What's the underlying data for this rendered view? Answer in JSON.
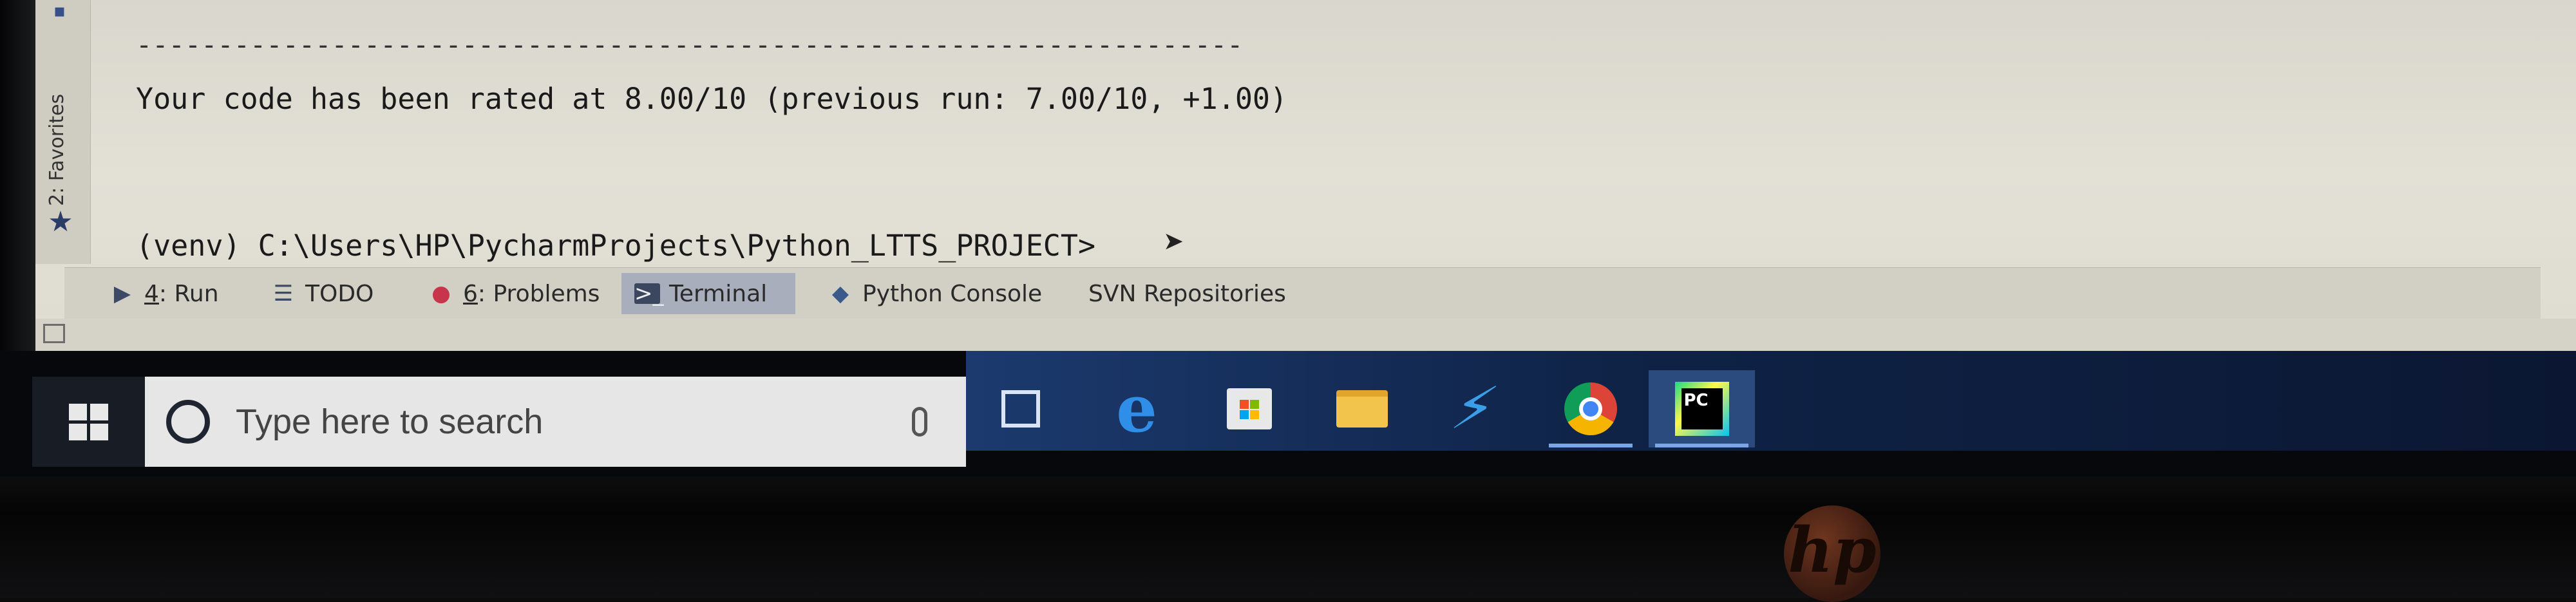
{
  "ide": {
    "favorites_label": "2: Favorites",
    "terminal": {
      "dashes": "--------------------------------------------------------------------",
      "rating_line": "Your code has been rated at 8.00/10 (previous run: 7.00/10, +1.00)",
      "prompt_line": "(venv) C:\\Users\\HP\\PycharmProjects\\Python_LTTS_PROJECT>"
    },
    "tabs": [
      {
        "num": "4",
        "label": ": Run",
        "icon": "run-icon"
      },
      {
        "label": "TODO",
        "icon": "todo-icon"
      },
      {
        "num": "6",
        "label": ": Problems",
        "icon": "problems-icon"
      },
      {
        "label": "Terminal",
        "icon": "terminal-icon",
        "active": true
      },
      {
        "label": "Python Console",
        "icon": "python-icon"
      },
      {
        "label": "SVN Repositories"
      }
    ]
  },
  "taskbar": {
    "search_placeholder": "Type here to search",
    "apps": [
      "task-view",
      "edge",
      "store",
      "file-explorer",
      "visual-studio",
      "chrome",
      "pycharm"
    ],
    "pycharm_label": "PC"
  },
  "hardware": {
    "brand": "hp"
  },
  "colors": {
    "terminal_bg": "#e3e1d6",
    "active_tab": "#a9aebd",
    "taskbar_blue": "#1c3a6e"
  }
}
